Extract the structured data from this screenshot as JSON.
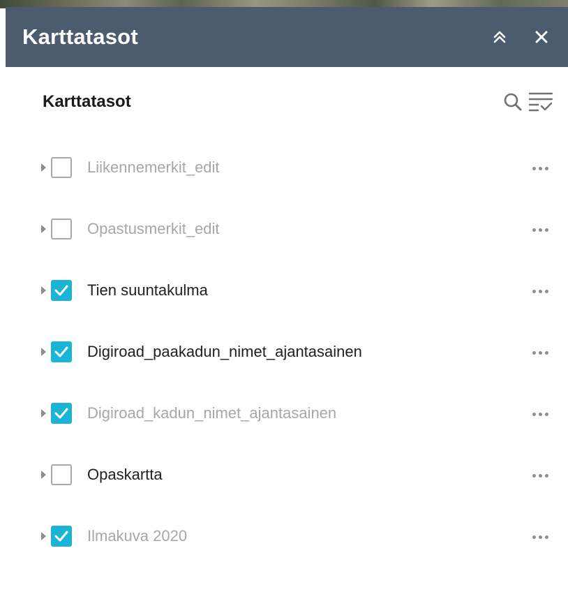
{
  "panel": {
    "title": "Karttatasot",
    "collapse_icon": "double-chevron-up-icon",
    "close_icon": "close-icon",
    "header_color": "#4d5b6f"
  },
  "layer_list": {
    "title": "Karttatasot",
    "search_icon": "search-icon",
    "filter_icon": "filter-list-icon",
    "accent_color": "#19b4d6",
    "layers": [
      {
        "label": "Liikennemerkit_edit",
        "checked": false,
        "dimmed": true
      },
      {
        "label": "Opastusmerkit_edit",
        "checked": false,
        "dimmed": true
      },
      {
        "label": "Tien suuntakulma",
        "checked": true,
        "dimmed": false
      },
      {
        "label": "Digiroad_paakadun_nimet_ajantasainen",
        "checked": true,
        "dimmed": false
      },
      {
        "label": "Digiroad_kadun_nimet_ajantasainen",
        "checked": true,
        "dimmed": true
      },
      {
        "label": "Opaskartta",
        "checked": false,
        "dimmed": false
      },
      {
        "label": "Ilmakuva 2020",
        "checked": true,
        "dimmed": true
      }
    ]
  }
}
